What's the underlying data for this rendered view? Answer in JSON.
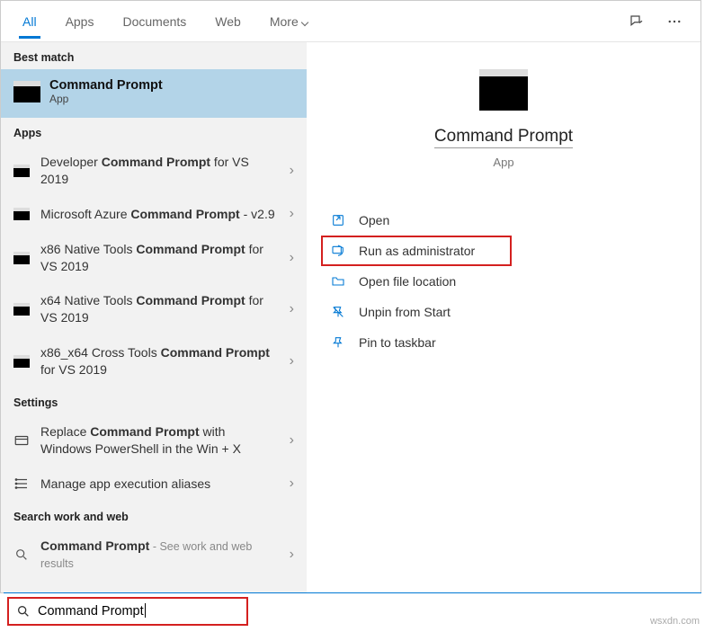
{
  "tabs": {
    "all": "All",
    "apps": "Apps",
    "documents": "Documents",
    "web": "Web",
    "more": "More"
  },
  "sections": {
    "best_match": "Best match",
    "apps": "Apps",
    "settings": "Settings",
    "search_web": "Search work and web"
  },
  "best_match": {
    "title": "Command Prompt",
    "sub": "App"
  },
  "apps_list": [
    {
      "pre": "Developer ",
      "q": "Command Prompt",
      "post": " for VS 2019"
    },
    {
      "pre": "Microsoft Azure ",
      "q": "Command Prompt",
      "post": " - v2.9"
    },
    {
      "pre": "x86 Native Tools ",
      "q": "Command Prompt",
      "post": " for VS 2019"
    },
    {
      "pre": "x64 Native Tools ",
      "q": "Command Prompt",
      "post": " for VS 2019"
    },
    {
      "pre": "x86_x64 Cross Tools ",
      "q": "Command Prompt",
      "post": " for VS 2019"
    }
  ],
  "settings_list": [
    {
      "pre": "Replace ",
      "q": "Command Prompt",
      "post": " with Windows PowerShell in the Win + X"
    },
    {
      "pre": "Manage app execution aliases",
      "q": "",
      "post": ""
    }
  ],
  "web_list": [
    {
      "q": "Command Prompt",
      "meta": " - See work and web results"
    }
  ],
  "right": {
    "title": "Command Prompt",
    "sub": "App"
  },
  "actions": {
    "open": "Open",
    "run_admin": "Run as administrator",
    "open_loc": "Open file location",
    "unpin": "Unpin from Start",
    "pin_taskbar": "Pin to taskbar"
  },
  "search_value": "Command Prompt",
  "watermark": "wsxdn.com"
}
